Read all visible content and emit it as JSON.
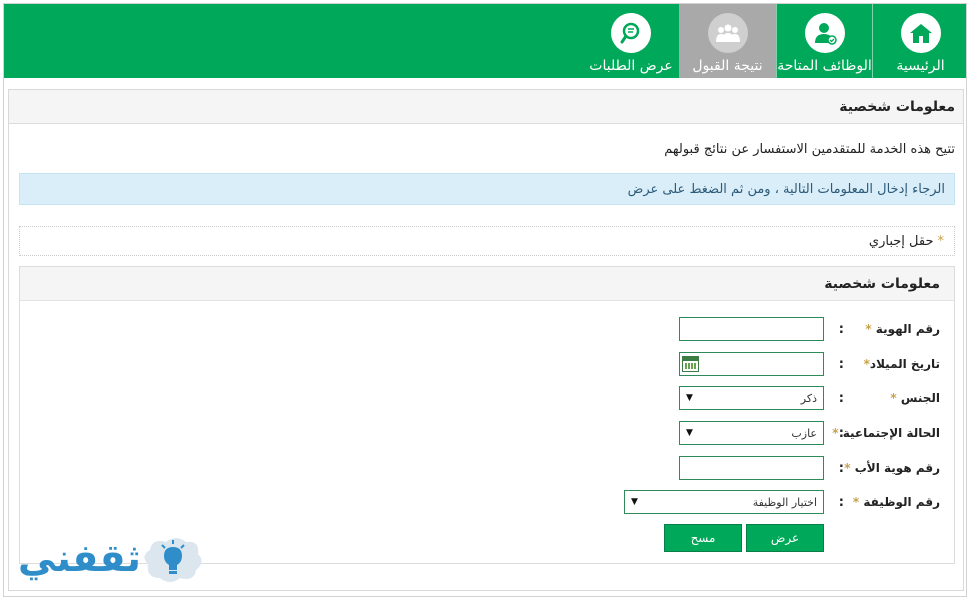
{
  "nav": {
    "tabs": [
      {
        "label": "الرئيسية",
        "icon": "home-icon"
      },
      {
        "label": "الوظائف المتاحة",
        "icon": "user-check-icon"
      },
      {
        "label": "نتيجة القبول",
        "icon": "group-icon",
        "active": true
      },
      {
        "label": "عرض الطلبات",
        "icon": "search-document-icon"
      }
    ]
  },
  "page": {
    "title": "معلومات شخصية",
    "intro": "تتيح هذه الخدمة للمتقدمين الاستفسار عن نتائج قبولهم",
    "alert": "الرجاء إدخال المعلومات التالية ، ومن ثم الضغط على عرض",
    "required_note": "حقل إجباري",
    "required_mark": "*"
  },
  "form": {
    "title": "معلومات شخصية",
    "colon": ":",
    "fields": {
      "id_number": {
        "label": "رقم الهوية",
        "value": ""
      },
      "birth_date": {
        "label": "تاريخ الميلاد",
        "value": ""
      },
      "gender": {
        "label": "الجنس",
        "selected": "ذكر"
      },
      "marital_status": {
        "label": "الحالة الإجتماعية",
        "selected": "عازب"
      },
      "father_id": {
        "label": "رقم هوية الأب",
        "value": ""
      },
      "job_number": {
        "label": "رقم الوظيفة",
        "selected": "اختيار الوظيفة"
      }
    },
    "buttons": {
      "show": "عرض",
      "clear": "مسح"
    }
  },
  "watermark": {
    "text": "ثقفني"
  },
  "colors": {
    "brand_green": "#00a859",
    "active_tab": "#a9a9a9",
    "alert_bg": "#d9eef8",
    "logo_blue": "#2f8ec9"
  }
}
